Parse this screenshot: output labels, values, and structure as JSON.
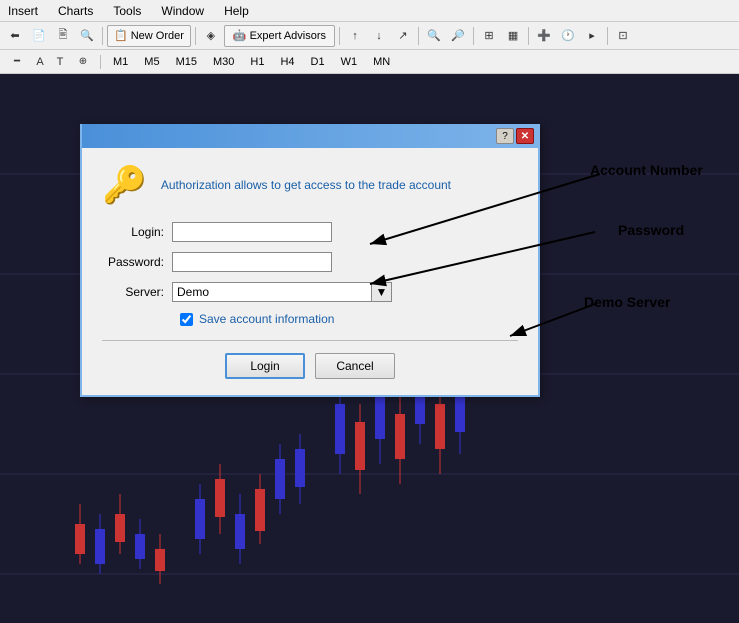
{
  "menubar": {
    "items": [
      "Insert",
      "Charts",
      "Tools",
      "Window",
      "Help"
    ]
  },
  "toolbar": {
    "new_order_label": "New Order",
    "expert_advisors_label": "Expert Advisors"
  },
  "timebar": {
    "items": [
      "M1",
      "M5",
      "M15",
      "M30",
      "H1",
      "H4",
      "D1",
      "W1",
      "MN"
    ]
  },
  "dialog": {
    "title": "",
    "help_label": "?",
    "close_label": "✕",
    "header_text": "Authorization allows to get access to the trade account",
    "login_label": "Login:",
    "login_value": "",
    "password_label": "Password:",
    "password_value": "",
    "server_label": "Server:",
    "server_value": "Demo",
    "checkbox_label": "Save account information",
    "checkbox_checked": true,
    "login_btn": "Login",
    "cancel_btn": "Cancel"
  },
  "annotations": {
    "account_number": "Account Number",
    "password": "Password",
    "demo_server": "Demo Server"
  },
  "colors": {
    "accent_blue": "#4a90d9",
    "key_gold": "#d4a017",
    "text_blue": "#1a5fa8"
  }
}
